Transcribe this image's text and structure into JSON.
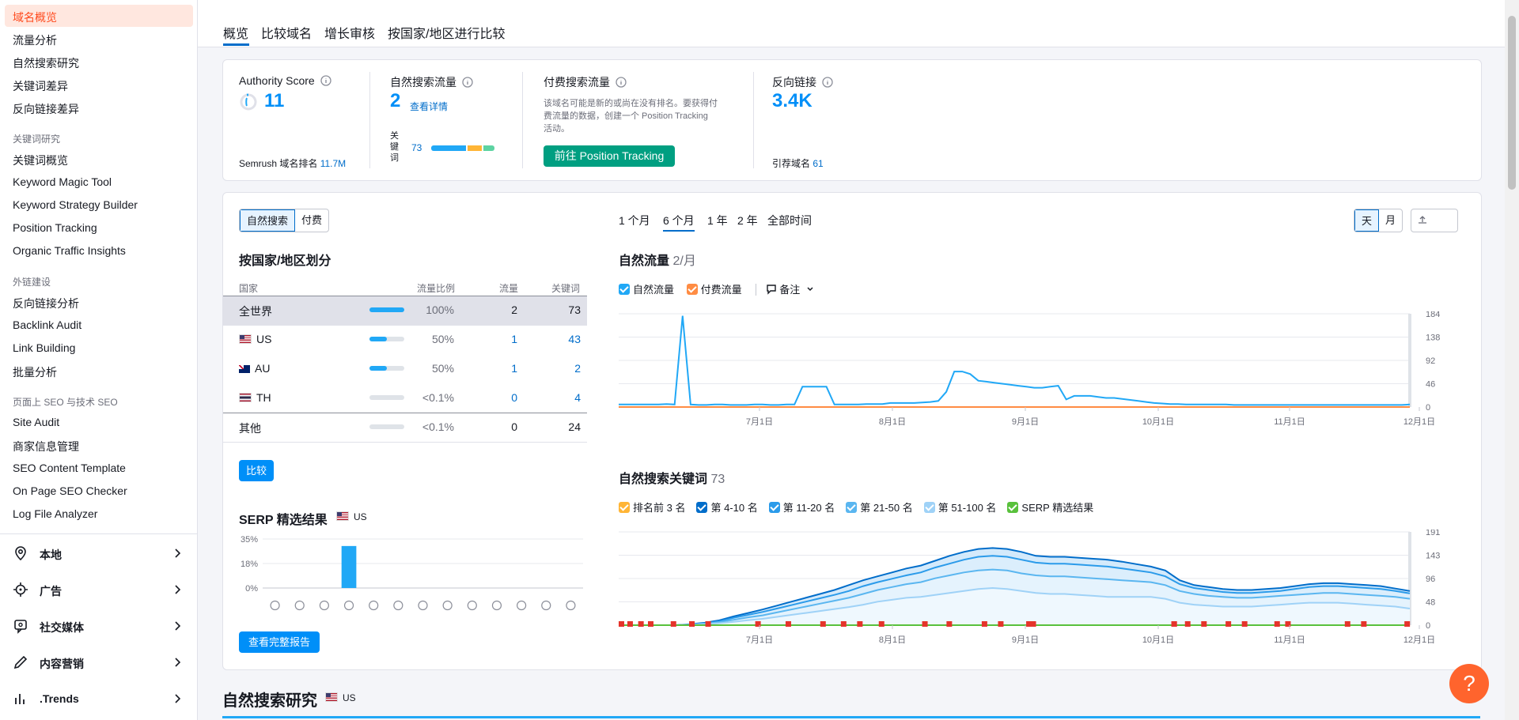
{
  "sidebar": {
    "active": "域名概览",
    "items": [
      "流量分析",
      "自然搜索研究",
      "关键词差异",
      "反向链接差异"
    ],
    "sec_keyword": "关键词研究",
    "keyword_items": [
      "关键词概览",
      "Keyword Magic Tool",
      "Keyword Strategy Builder",
      "Position Tracking",
      "Organic Traffic Insights"
    ],
    "sec_links": "外链建设",
    "link_items": [
      "反向链接分析",
      "Backlink Audit",
      "Link Building",
      "批量分析"
    ],
    "sec_onpage": "页面上 SEO 与技术 SEO",
    "onpage_items": [
      "Site Audit",
      "商家信息管理",
      "SEO Content Template",
      "On Page SEO Checker",
      "Log File Analyzer"
    ],
    "groups": [
      {
        "label": "本地",
        "icon": "location-pin-icon"
      },
      {
        "label": "广告",
        "icon": "crosshair-icon"
      },
      {
        "label": "社交媒体",
        "icon": "social-chat-icon"
      },
      {
        "label": "内容营销",
        "icon": "pencil-icon"
      },
      {
        "label": ".Trends",
        "icon": "bar-chart-icon"
      }
    ]
  },
  "tabs": [
    "概览",
    "比较域名",
    "增长审核",
    "按国家/地区进行比较"
  ],
  "summary": {
    "authority_label": "Authority Score",
    "authority_value": "11",
    "rank_label": "Semrush 域名排名",
    "rank_value": "11.7M",
    "organic_label": "自然搜索流量",
    "organic_value": "2",
    "organic_link": "查看详情",
    "keywords_label": "关键词",
    "keywords_value": "73",
    "paid_label": "付费搜索流量",
    "paid_desc_1": "该域名可能是新的或尚在没有排名。要获得付",
    "paid_desc_2": "费流量的数据，创建一个 Position Tracking",
    "paid_desc_3": "活动。",
    "paid_button": "前往 Position Tracking",
    "backlinks_label": "反向链接",
    "backlinks_value": "3.4K",
    "ref_domains_label": "引荐域名",
    "ref_domains_value": "61"
  },
  "left_panel": {
    "seg_organic": "自然搜索",
    "seg_paid": "付费",
    "country_title": "按国家/地区划分",
    "col_country": "国家",
    "col_share": "流量比例",
    "col_traffic": "流量",
    "col_keywords": "关键词",
    "rows": [
      {
        "name": "全世界",
        "share": "100%",
        "share_frac": 1.0,
        "traffic": "2",
        "keywords": "73",
        "flag": ""
      },
      {
        "name": "US",
        "share": "50%",
        "share_frac": 0.5,
        "traffic": "1",
        "keywords": "43",
        "flag": "us"
      },
      {
        "name": "AU",
        "share": "50%",
        "share_frac": 0.5,
        "traffic": "1",
        "keywords": "2",
        "flag": "au"
      },
      {
        "name": "TH",
        "share": "<0.1%",
        "share_frac": 0.0,
        "traffic": "0",
        "keywords": "4",
        "flag": "th"
      },
      {
        "name": "其他",
        "share": "<0.1%",
        "share_frac": 0.0,
        "traffic": "0",
        "keywords": "24",
        "flag": ""
      }
    ],
    "compare_button": "比较",
    "serp_title": "SERP 精选结果",
    "serp_country": "US",
    "serp_ticks": [
      "35%",
      "18%",
      "0%"
    ],
    "serp_full_report": "查看完整报告"
  },
  "right_panel": {
    "periods": [
      "1 个月",
      "6 个月",
      "1 年",
      "2 年",
      "全部时间"
    ],
    "active_period": "6 个月",
    "day_btn": "天",
    "month_btn": "月",
    "export_btn": "导出",
    "traffic_title": "自然流量",
    "traffic_sub": "2/月",
    "legend_organic": "自然流量",
    "legend_paid": "付费流量",
    "notes": "备注",
    "kw_title": "自然搜索关键词",
    "kw_count": "73",
    "kw_legend": [
      "排名前 3 名",
      "第 4-10 名",
      "第 11-20 名",
      "第 21-50 名",
      "第 51-100 名",
      "SERP 精选结果"
    ]
  },
  "organic_research": {
    "title": "自然搜索研究",
    "country": "US"
  },
  "colors": {
    "accent": "#006dca",
    "active_bg": "#ffe7df",
    "active_text": "#ff4a1d",
    "green_btn": "#009f81",
    "chart_blue": "#21a8f6",
    "paid_orange": "#ff8c43"
  },
  "help_label": "?",
  "chart_data": [
    {
      "type": "line",
      "title": "自然流量",
      "x": [
        "7月1日",
        "8月1日",
        "9月1日",
        "10月1日",
        "11月1日",
        "12月1日"
      ],
      "yticks": [
        184,
        138,
        92,
        46,
        0
      ],
      "ylim": [
        0,
        184
      ],
      "series": [
        {
          "name": "自然流量",
          "color": "#21a8f6",
          "values": [
            5,
            5,
            5,
            5,
            5,
            5,
            6,
            5,
            180,
            5,
            4,
            4,
            5,
            5,
            4,
            4,
            4,
            5,
            5,
            4,
            4,
            5,
            5,
            40,
            40,
            40,
            40,
            5,
            5,
            5,
            5,
            6,
            6,
            6,
            8,
            8,
            8,
            8,
            9,
            10,
            12,
            30,
            70,
            70,
            65,
            52,
            50,
            48,
            46,
            44,
            42,
            40,
            38,
            38,
            40,
            42,
            15,
            22,
            22,
            22,
            20,
            18,
            18,
            16,
            14,
            12,
            10,
            8,
            7,
            6,
            6,
            5,
            5,
            5,
            5,
            5,
            5,
            4,
            4,
            4,
            4,
            4,
            4,
            4,
            4,
            4,
            4,
            4,
            4,
            4,
            4,
            4,
            4,
            4,
            4,
            4,
            4,
            4,
            4,
            5
          ]
        },
        {
          "name": "付费流量",
          "color": "#ff8c43",
          "values": [
            0,
            0,
            0,
            0,
            0,
            0,
            0,
            0,
            0,
            0,
            0,
            0,
            0,
            0,
            0,
            0,
            0,
            0,
            0,
            0,
            0,
            0,
            0,
            0,
            0,
            0,
            0,
            0,
            0,
            0,
            0,
            0,
            0,
            0,
            0,
            0,
            0,
            0,
            0,
            0,
            0,
            0,
            0,
            0,
            0,
            0,
            0,
            0,
            0,
            0,
            0,
            0,
            0,
            0,
            0,
            0,
            0,
            0,
            0,
            0,
            0,
            0,
            0,
            0,
            0,
            0,
            0,
            0,
            0,
            0,
            0,
            0,
            0,
            0,
            0,
            0,
            0,
            0,
            0,
            0,
            0,
            0,
            0,
            0,
            0,
            0,
            0,
            0,
            0,
            0,
            0,
            0,
            0,
            0,
            0,
            0,
            0,
            0,
            0,
            0
          ]
        }
      ]
    },
    {
      "type": "area",
      "title": "自然搜索关键词",
      "x": [
        "7月1日",
        "8月1日",
        "9月1日",
        "10月1日",
        "11月1日",
        "12月1日"
      ],
      "yticks": [
        191,
        143,
        96,
        48,
        0
      ],
      "ylim": [
        0,
        191
      ],
      "series": [
        {
          "name": "第 4-10 名",
          "color": "#006dca",
          "values": [
            0,
            0,
            0,
            0,
            0,
            2,
            5,
            10,
            18,
            25,
            32,
            40,
            48,
            56,
            64,
            72,
            82,
            92,
            100,
            108,
            116,
            122,
            132,
            142,
            150,
            156,
            158,
            156,
            150,
            142,
            140,
            140,
            138,
            136,
            134,
            130,
            125,
            120,
            112,
            92,
            82,
            78,
            74,
            72,
            72,
            74,
            76,
            80,
            84,
            86,
            86,
            84,
            82,
            80,
            75,
            70
          ]
        },
        {
          "name": "第 11-20 名",
          "color": "#2b9bea",
          "values": [
            0,
            0,
            0,
            0,
            0,
            1,
            4,
            8,
            15,
            21,
            27,
            34,
            41,
            48,
            55,
            62,
            70,
            80,
            88,
            95,
            102,
            108,
            118,
            126,
            134,
            140,
            142,
            140,
            134,
            128,
            126,
            126,
            124,
            122,
            120,
            116,
            112,
            108,
            100,
            84,
            76,
            72,
            68,
            66,
            66,
            68,
            70,
            74,
            78,
            80,
            80,
            78,
            76,
            74,
            70,
            65
          ]
        },
        {
          "name": "第 21-50 名",
          "color": "#5ab6f0",
          "values": [
            0,
            0,
            0,
            0,
            0,
            1,
            3,
            6,
            11,
            16,
            20,
            26,
            32,
            38,
            44,
            50,
            56,
            64,
            72,
            78,
            84,
            88,
            96,
            102,
            108,
            112,
            114,
            112,
            106,
            102,
            100,
            100,
            98,
            96,
            94,
            92,
            90,
            88,
            82,
            70,
            64,
            60,
            58,
            56,
            56,
            58,
            60,
            62,
            64,
            66,
            66,
            64,
            62,
            60,
            58,
            54
          ]
        },
        {
          "name": "第 51-100 名",
          "color": "#9fd2f7",
          "values": [
            0,
            0,
            0,
            0,
            0,
            1,
            2,
            4,
            7,
            10,
            13,
            17,
            21,
            25,
            29,
            33,
            37,
            42,
            48,
            52,
            56,
            58,
            62,
            66,
            70,
            74,
            76,
            74,
            70,
            66,
            64,
            64,
            62,
            60,
            58,
            58,
            58,
            58,
            54,
            46,
            42,
            40,
            38,
            38,
            38,
            40,
            42,
            44,
            46,
            46,
            46,
            44,
            42,
            40,
            38,
            34
          ]
        },
        {
          "name": "SERP 精选结果",
          "color": "#59c13c",
          "values": [
            0,
            0,
            0,
            0,
            0,
            0,
            0,
            0,
            0,
            0,
            0,
            0,
            0,
            0,
            0,
            0,
            0,
            0,
            0,
            0,
            0,
            0,
            0,
            0,
            0,
            0,
            0,
            0,
            0,
            0,
            0,
            0,
            0,
            0,
            0,
            0,
            0,
            0,
            0,
            0,
            0,
            0,
            0,
            0,
            0,
            0,
            0,
            0,
            0,
            0,
            0,
            0,
            0,
            0,
            0,
            0
          ]
        }
      ]
    },
    {
      "type": "bar",
      "title": "SERP 精选结果",
      "yticks": [
        "35%",
        "18%",
        "0%"
      ],
      "ylim": [
        0,
        35
      ],
      "values": [
        0,
        0,
        0,
        30,
        0,
        0,
        0,
        0,
        0,
        0,
        0,
        0,
        0
      ]
    }
  ]
}
